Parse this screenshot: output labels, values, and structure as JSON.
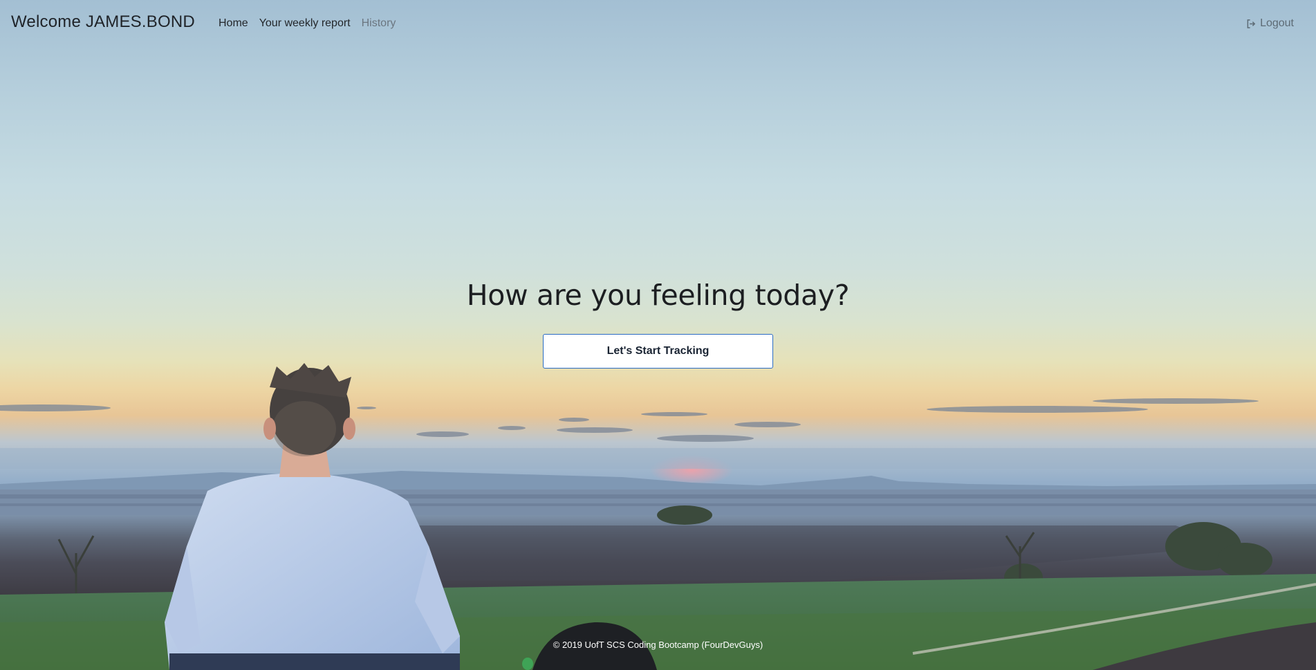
{
  "navbar": {
    "brand": "Welcome JAMES.BOND",
    "links": [
      {
        "label": "Home"
      },
      {
        "label": "Your weekly report"
      },
      {
        "label": "History"
      }
    ],
    "logout_label": "Logout",
    "logout_icon": "sign-out-icon"
  },
  "hero": {
    "title": "How are you feeling today?",
    "button_label": "Let's Start Tracking"
  },
  "footer": {
    "text": "© 2019 UofT SCS Coding Bootcamp (FourDevGuys)"
  },
  "colors": {
    "text_dark": "#1c1e21",
    "link_muted": "#6b7680",
    "button_border": "#2b6cc4"
  }
}
